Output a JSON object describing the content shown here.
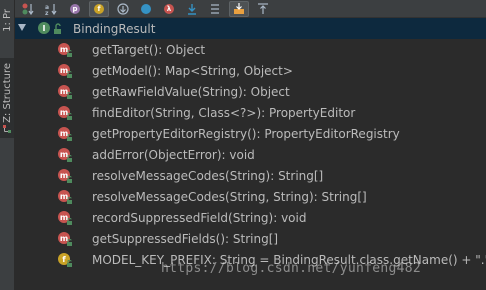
{
  "side_panel": {
    "tab_project": "1: Pr",
    "tab_structure": "Z: Structure"
  },
  "toolbar": {
    "buttons": [
      "sort-by-visibility",
      "sort-alphabetically",
      "show-properties",
      "show-fields",
      "show-inherited",
      "show-non-public",
      "show-lambdas",
      "expand-all",
      "collapse-all",
      "autoscroll-to-source",
      "autoscroll-from-source"
    ]
  },
  "tree": {
    "root": {
      "label": "BindingResult",
      "icon": "interface-icon"
    },
    "items": [
      {
        "label": "getTarget(): Object",
        "icon": "method-icon"
      },
      {
        "label": "getModel(): Map<String, Object>",
        "icon": "method-icon"
      },
      {
        "label": "getRawFieldValue(String): Object",
        "icon": "method-icon"
      },
      {
        "label": "findEditor(String, Class<?>): PropertyEditor",
        "icon": "method-icon"
      },
      {
        "label": "getPropertyEditorRegistry(): PropertyEditorRegistry",
        "icon": "method-icon"
      },
      {
        "label": "addError(ObjectError): void",
        "icon": "method-icon"
      },
      {
        "label": "resolveMessageCodes(String): String[]",
        "icon": "method-icon"
      },
      {
        "label": "resolveMessageCodes(String, String): String[]",
        "icon": "method-icon"
      },
      {
        "label": "recordSuppressedField(String): void",
        "icon": "method-icon"
      },
      {
        "label": "getSuppressedFields(): String[]",
        "icon": "method-icon"
      },
      {
        "label": "MODEL_KEY_PREFIX: String = BindingResult.class.getName() + \".\"",
        "icon": "field-icon"
      }
    ]
  },
  "watermark": "https://blog.csdn.net/yunfeng482"
}
